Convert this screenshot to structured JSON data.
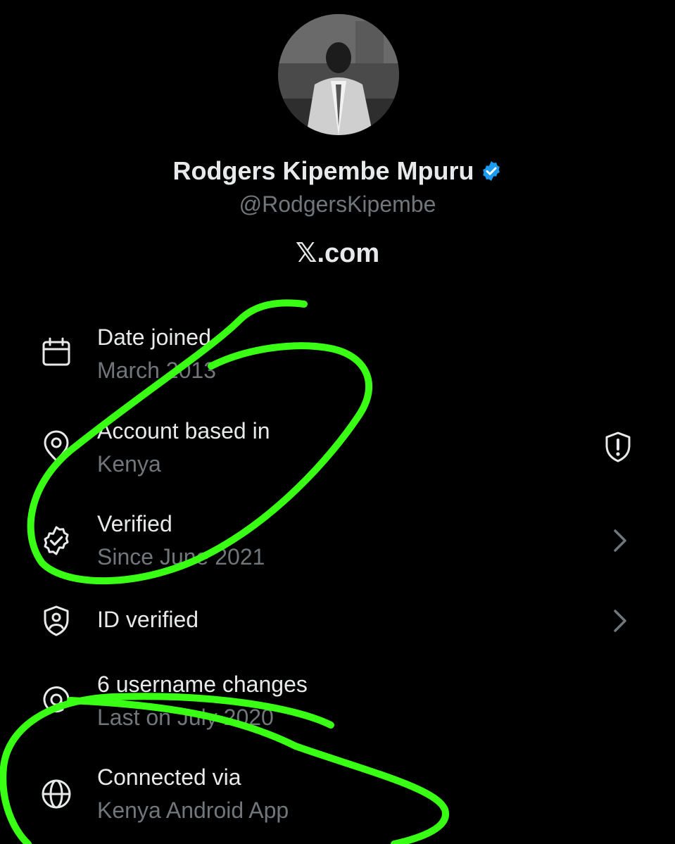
{
  "profile": {
    "name": "Rodgers Kipembe Mpuru",
    "handle": "@RodgersKipembe",
    "brand": "𝕏.com",
    "avatar_icon": "profile-photo",
    "verified_badge_icon": "verified-badge-icon",
    "verified_badge_color": "#1d9bf0"
  },
  "details": [
    {
      "title": "Date joined",
      "subtitle": "March 2013",
      "icon": "calendar-icon"
    },
    {
      "title": "Account based in",
      "subtitle": "Kenya",
      "icon": "location-pin-icon",
      "trailing_icon": "shield-alert-icon"
    },
    {
      "title": "Verified",
      "subtitle": "Since June 2021",
      "icon": "verified-check-icon",
      "trailing_icon": "chevron-right-icon"
    },
    {
      "title": "ID verified",
      "subtitle": "",
      "icon": "id-shield-icon",
      "trailing_icon": "chevron-right-icon"
    },
    {
      "title": "6 username changes",
      "subtitle": "Last on July 2020",
      "icon": "at-sign-icon"
    },
    {
      "title": "Connected via",
      "subtitle": "Kenya Android App",
      "icon": "globe-icon"
    }
  ],
  "colors": {
    "background": "#000000",
    "primary_text": "#e7e9ea",
    "secondary_text": "#71767b",
    "annotation": "#39ff14"
  }
}
